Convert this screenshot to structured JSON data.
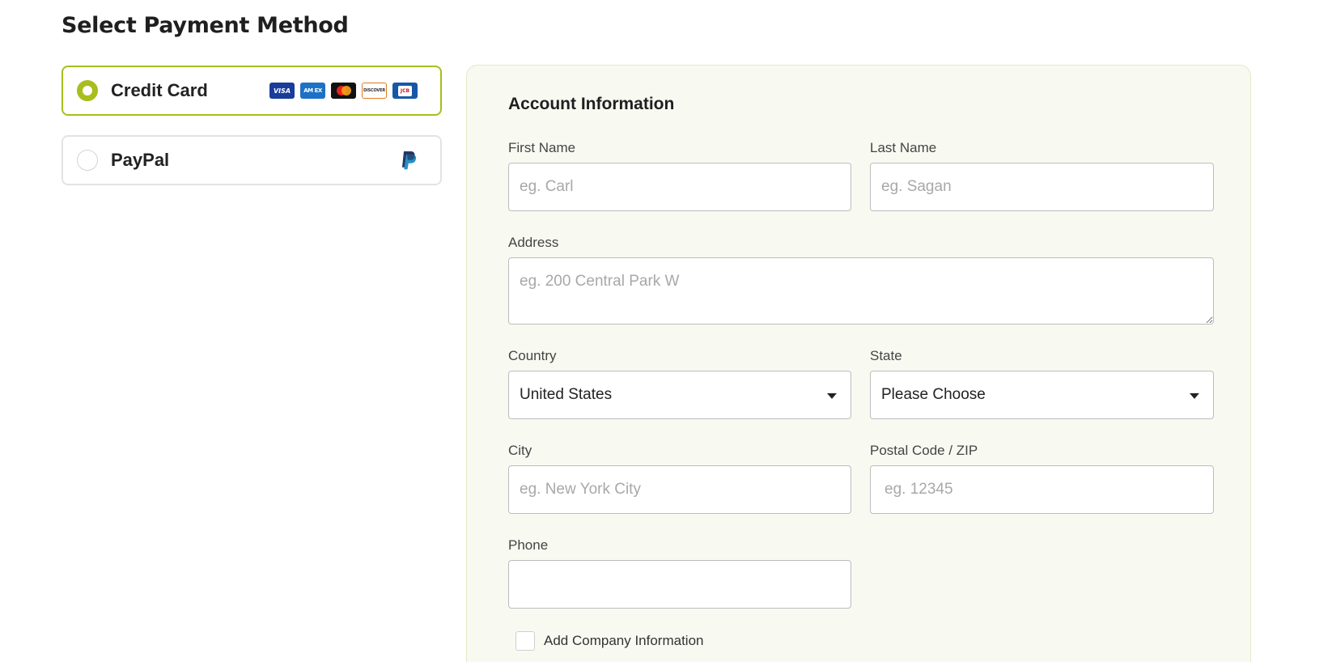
{
  "page": {
    "title": "Select Payment Method"
  },
  "payment_methods": [
    {
      "label": "Credit Card",
      "selected": true,
      "brands": [
        "VISA",
        "AMEX",
        "Mastercard",
        "DISCOVER",
        "JCB"
      ]
    },
    {
      "label": "PayPal",
      "selected": false
    }
  ],
  "brand_labels": {
    "visa": "VISA",
    "amex": "AM EX",
    "discover": "DISCOVER",
    "jcb": "JCB"
  },
  "account": {
    "title": "Account Information",
    "first_name": {
      "label": "First Name",
      "placeholder": "eg. Carl",
      "value": ""
    },
    "last_name": {
      "label": "Last Name",
      "placeholder": "eg. Sagan",
      "value": ""
    },
    "address": {
      "label": "Address",
      "placeholder": "eg. 200 Central Park W",
      "value": ""
    },
    "country": {
      "label": "Country",
      "value": "United States"
    },
    "state": {
      "label": "State",
      "value": "Please Choose"
    },
    "city": {
      "label": "City",
      "placeholder": "eg. New York City",
      "value": ""
    },
    "postal": {
      "label": "Postal Code / ZIP",
      "placeholder": "eg. 12345",
      "value": ""
    },
    "phone": {
      "label": "Phone",
      "placeholder": "",
      "value": ""
    },
    "company_checkbox": {
      "label": "Add Company Information",
      "checked": false
    }
  },
  "colors": {
    "accent": "#a8be1c",
    "panel_background": "#f8faf2",
    "panel_border": "#e2ebc4"
  }
}
